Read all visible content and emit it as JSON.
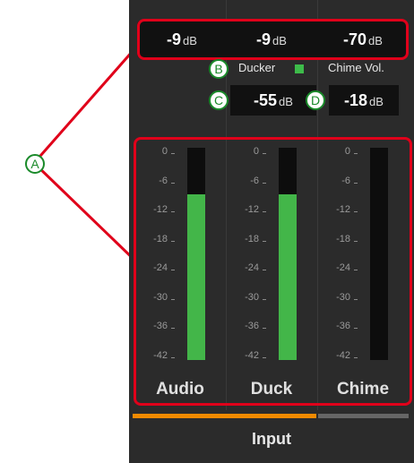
{
  "levels": [
    {
      "value": "-9",
      "unit": "dB"
    },
    {
      "value": "-9",
      "unit": "dB"
    },
    {
      "value": "-70",
      "unit": "dB"
    }
  ],
  "ducker": {
    "label": "Ducker",
    "value": "-55",
    "unit": "dB",
    "indicator_color": "#3dbb4a"
  },
  "chime": {
    "label": "Chime Vol.",
    "value": "-18",
    "unit": "dB"
  },
  "scale_ticks": [
    "0",
    "-6",
    "-12",
    "-18",
    "-24",
    "-30",
    "-36",
    "-42"
  ],
  "channels": [
    {
      "name": "Audio",
      "meter_fraction": 0.78
    },
    {
      "name": "Duck",
      "meter_fraction": 0.78
    },
    {
      "name": "Chime",
      "meter_fraction": 0.0
    }
  ],
  "footer": {
    "label": "Input"
  },
  "callouts": {
    "a": "A",
    "b": "B",
    "c": "C",
    "d": "D"
  },
  "colors": {
    "meter_fill": "#43b649",
    "active_tab": "#f08a00",
    "annotation": "#e0001a",
    "callout": "#1a8a2a"
  }
}
